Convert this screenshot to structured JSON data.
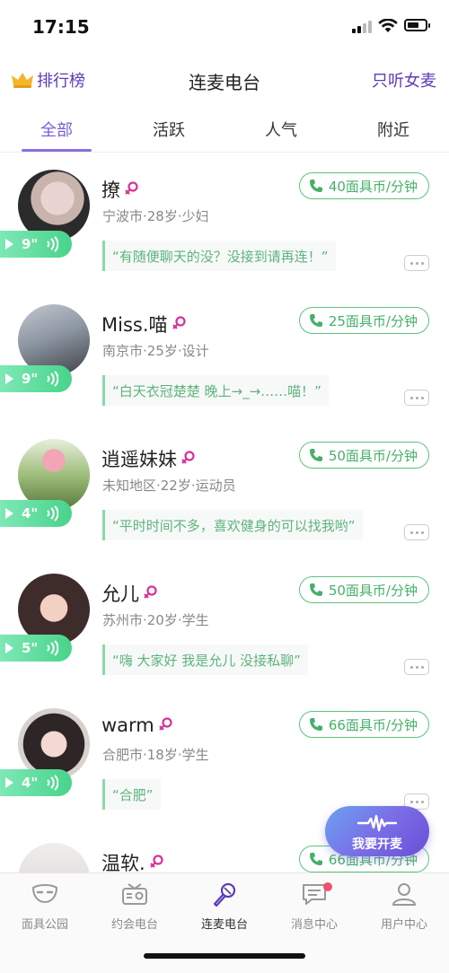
{
  "status": {
    "time": "17:15"
  },
  "header": {
    "rank_label": "排行榜",
    "title": "连麦电台",
    "filter_label": "只听女麦"
  },
  "tabs": [
    {
      "label": "全部",
      "active": true
    },
    {
      "label": "活跃"
    },
    {
      "label": "人气"
    },
    {
      "label": "附近"
    }
  ],
  "cards": [
    {
      "name": "撩",
      "info": "宁波市·28岁·少妇",
      "price": "40面具币/分钟",
      "duration": "9\"",
      "quote": "“有随便聊天的没？没接到请再连！”"
    },
    {
      "name": "Miss.喵",
      "info": "南京市·25岁·设计",
      "price": "25面具币/分钟",
      "duration": "9\"",
      "quote": "“白天衣冠楚楚 晚上→_→……喵！”"
    },
    {
      "name": "逍遥妹妹",
      "info": "未知地区·22岁·运动员",
      "price": "50面具币/分钟",
      "duration": "4\"",
      "quote": "“平时时间不多，喜欢健身的可以找我哟”"
    },
    {
      "name": "允儿",
      "info": "苏州市·20岁·学生",
      "price": "50面具币/分钟",
      "duration": "5\"",
      "quote": "“嗨 大家好 我是允儿 没接私聊”"
    },
    {
      "name": "warm",
      "info": "合肥市·18岁·学生",
      "price": "66面具币/分钟",
      "duration": "4\"",
      "quote": "“合肥”"
    },
    {
      "name": "温软.",
      "info": "",
      "price": "66面具币/分钟",
      "duration": "",
      "quote": ""
    }
  ],
  "fab": {
    "label": "我要开麦"
  },
  "nav": [
    {
      "label": "面具公园",
      "icon": "mask-icon"
    },
    {
      "label": "约会电台",
      "icon": "radio-icon"
    },
    {
      "label": "连麦电台",
      "icon": "microphone-icon",
      "active": true
    },
    {
      "label": "消息中心",
      "icon": "message-icon",
      "badge": true
    },
    {
      "label": "用户中心",
      "icon": "user-icon"
    }
  ],
  "colors": {
    "accent": "#7a5fd6",
    "green": "#46b06a",
    "gender": "#d6329a"
  }
}
